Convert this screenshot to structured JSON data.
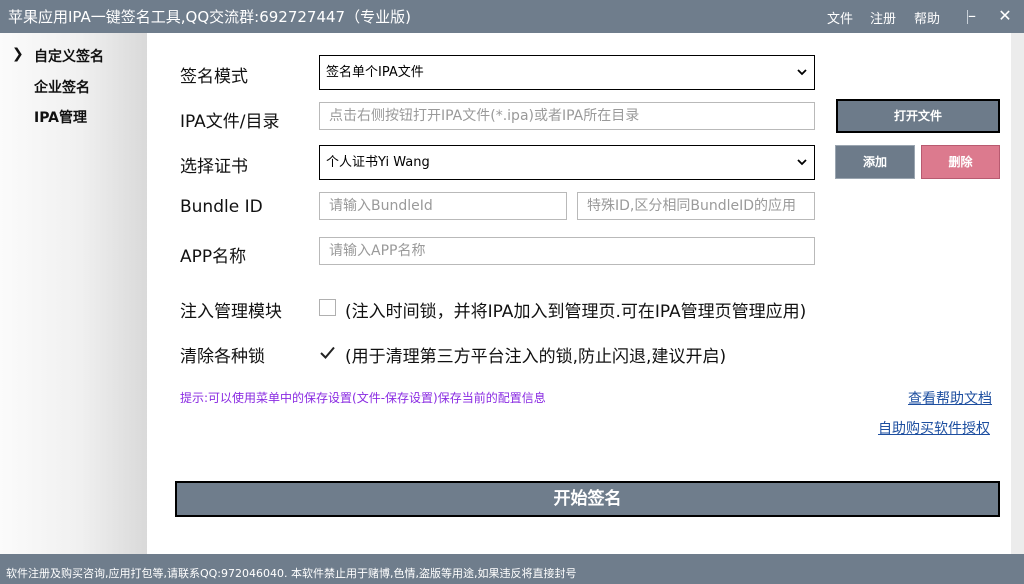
{
  "titlebar": {
    "title": "苹果应用IPA一键签名工具,QQ交流群:692727447（专业版)",
    "menu": [
      "文件",
      "注册",
      "帮助"
    ],
    "minimize": "–",
    "close": "✕"
  },
  "sidebar": {
    "items": [
      {
        "label": "自定义签名"
      },
      {
        "label": "企业签名"
      },
      {
        "label": "IPA管理"
      }
    ],
    "active_marker": "❯"
  },
  "form": {
    "sign_mode_label": "签名模式",
    "sign_mode_value": "签名单个IPA文件",
    "ipa_label": "IPA文件/目录",
    "ipa_placeholder": "点击右侧按钮打开IPA文件(*.ipa)或者IPA所在目录",
    "open_file_button": "打开文件",
    "cert_label": "选择证书",
    "cert_value": "个人证书Yi Wang",
    "add_button": "添加",
    "delete_button": "删除",
    "bundle_label": "Bundle ID",
    "bundle_placeholder": "请输入BundleId",
    "special_id_placeholder": "特殊ID,区分相同BundleID的应用",
    "app_name_label": "APP名称",
    "app_name_placeholder": "请输入APP名称",
    "inject_label": "注入管理模块",
    "inject_text": "(注入时间锁，并将IPA加入到管理页.可在IPA管理页管理应用)",
    "inject_checked": false,
    "clear_label": "清除各种锁",
    "clear_text": "(用于清理第三方平台注入的锁,防止闪退,建议开启)",
    "clear_checked": true
  },
  "hint": "提示:可以使用菜单中的保存设置(文件-保存设置)保存当前的配置信息",
  "links": {
    "help_docs": "查看帮助文档",
    "buy_license": "自助购买软件授权"
  },
  "start_button": "开始签名",
  "status_bar": "软件注册及购买咨询,应用打包等,请联系QQ:972046040.  本软件禁止用于赌博,色情,盗版等用途,如果违反将直接封号",
  "colors": {
    "titlebar_bg": "#6f7d8c",
    "button_gray": "#6d7b8a",
    "button_pink": "#dc7a8e",
    "hint_purple": "#8a2be2",
    "link_blue": "#1e4fa0"
  }
}
